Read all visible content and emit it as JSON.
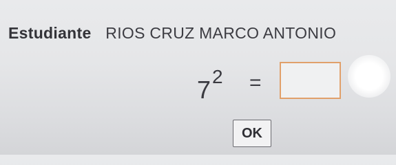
{
  "student": {
    "label": "Estudiante",
    "name": "RIOS CRUZ MARCO ANTONIO"
  },
  "problem": {
    "base": "7",
    "exponent": "2",
    "operator": "=",
    "answer_value": ""
  },
  "actions": {
    "ok_label": "OK"
  },
  "colors": {
    "answer_border": "#e1a06a"
  }
}
